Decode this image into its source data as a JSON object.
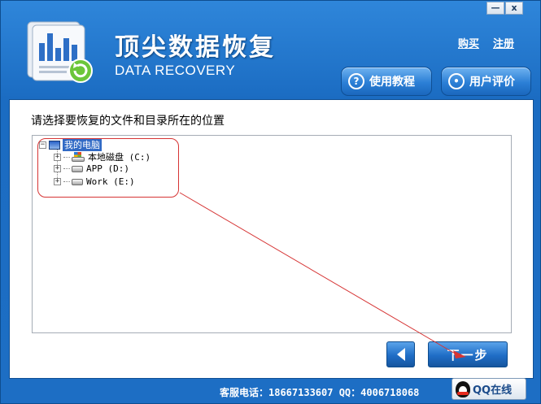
{
  "window": {
    "minimize_label": "—",
    "close_label": "x"
  },
  "header": {
    "title_cn": "顶尖数据恢复",
    "title_en": "DATA RECOVERY",
    "buy_label": "购买",
    "register_label": "注册",
    "tutorial_label": "使用教程",
    "review_label": "用户评价"
  },
  "main": {
    "prompt": "请选择要恢复的文件和目录所在的位置",
    "tree": {
      "root": "我的电脑",
      "drives": [
        {
          "label": "本地磁盘 (C:)"
        },
        {
          "label": "APP (D:)"
        },
        {
          "label": "Work (E:)"
        }
      ]
    }
  },
  "nav": {
    "next_label": "下一步"
  },
  "footer": {
    "contact": "客服电话：18667133607 QQ：4006718068",
    "qq_label": "QQ在线"
  },
  "colors": {
    "background": "#1d6ec4",
    "annotation": "#d63434",
    "selection": "#316ac5"
  }
}
